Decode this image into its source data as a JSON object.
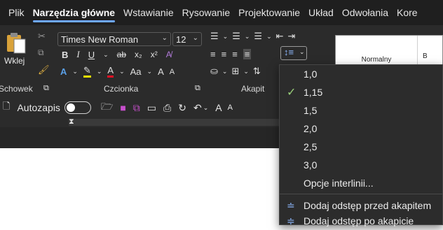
{
  "menu_tabs": [
    "Plik",
    "Narzędzia główne",
    "Wstawianie",
    "Rysowanie",
    "Projektowanie",
    "Układ",
    "Odwołania",
    "Kore"
  ],
  "ribbon": {
    "font_name": "Times New Roman",
    "font_size": "12",
    "paste_label": "Wklej",
    "groups": {
      "clipboard": "Schowek",
      "font": "Czcionka",
      "paragraph": "Akapit"
    },
    "styles": {
      "normal": "Normalny",
      "next": "B"
    },
    "change_case": "Aa",
    "grow_font": "A",
    "shrink_font": "A"
  },
  "qat": {
    "autosave_label": "Autozapis"
  },
  "line_spacing_menu": {
    "options": [
      "1,0",
      "1,15",
      "1,5",
      "2,0",
      "2,5",
      "3,0"
    ],
    "selected": "1,15",
    "more": "Opcje interlinii...",
    "add_before": "Dodaj odstęp przed akapitem",
    "add_after": "Dodaj odstęp po akapicie"
  },
  "colors": {
    "accent": "#6ea8ff",
    "check": "#9ad07a",
    "highlight": "#f2e600",
    "font_color": "#e81123",
    "save_icon": "#c74fcc"
  }
}
